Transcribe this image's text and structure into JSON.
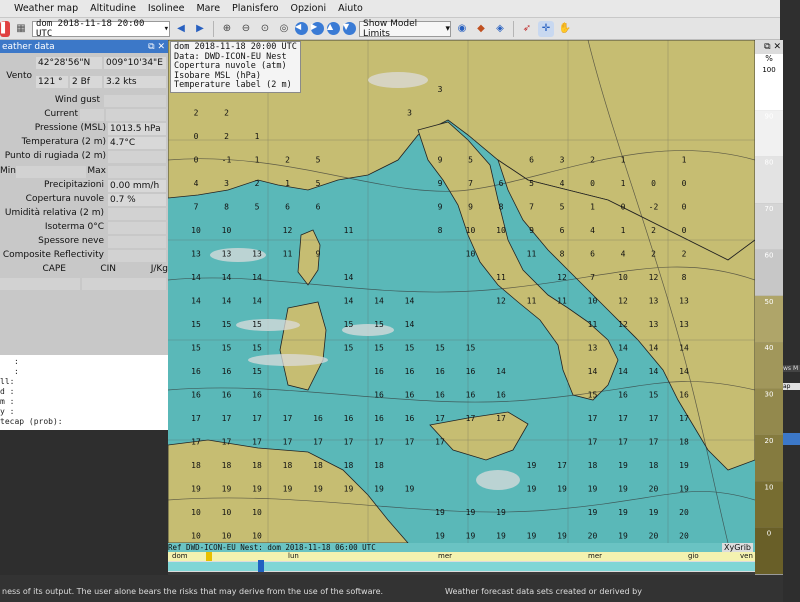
{
  "menu": [
    "Weather map",
    "Altitudine",
    "Isolinee",
    "Mare",
    "Planisfero",
    "Opzioni",
    "Aiuto"
  ],
  "toolbar": {
    "date_value": "dom 2018-11-18 20:00 UTC",
    "model_limits_label": "Show Model Limits"
  },
  "panel": {
    "title": "eather data",
    "lat": "42°28'56\"N",
    "lon": "009°10'34\"E",
    "wind_label": "Vento",
    "wind_dir": "121 °",
    "wind_bf": "2 Bf",
    "wind_kts": "3.2  kts",
    "wind_gust_label": "Wind gust",
    "current_label": "Current",
    "pressure_label": "Pressione (MSL)",
    "pressure_value": "1013.5 hPa",
    "temp_label": "Temperatura (2 m)",
    "temp_value": "4.7°C",
    "dew_label": "Punto di rugiada (2 m)",
    "min_label": "Min",
    "max_label": "Max",
    "precip_label": "Precipitazioni",
    "precip_value": "0.00 mm/h",
    "cloud_label": "Copertura nuvole",
    "cloud_value": "0.7 %",
    "humidity_label": "Umidità relativa (2 m)",
    "iso_label": "Isoterma 0°C",
    "snow_label": "Spessore neve",
    "reflect_label": "Composite Reflectivity",
    "cape_label": "CAPE",
    "cin_label": "CIN",
    "jkg_label": "J/Kg",
    "text_lines": [
      ":",
      ":",
      "ll:",
      "d :",
      "m :",
      "y :",
      "tecap (prob):"
    ],
    "text_prefixes": [
      "",
      "",
      "",
      "",
      "",
      "",
      ""
    ]
  },
  "map": {
    "header_lines": [
      "dom 2018-11-18 20:00 UTC",
      "Data: DWD-ICON-EU Nest",
      "Copertura nuvole (atm)",
      "Isobare MSL (hPa)",
      "Temperature label (2 m)"
    ],
    "footer": "Ref DWD-ICON-EU Nest: dom 2018-11-18 06:00 UTC",
    "brand": "XyGrib",
    "temps": [
      [
        "1",
        "2",
        "2",
        "0",
        "",
        "",
        "3",
        "1",
        "",
        "",
        "",
        "",
        "",
        "",
        "",
        "",
        "",
        ""
      ],
      [
        "2",
        "2",
        "1",
        "",
        "",
        "",
        "3",
        "",
        "",
        "",
        "",
        "",
        "",
        "",
        "",
        "",
        "",
        ""
      ],
      [
        "0",
        "2",
        "1",
        "",
        "",
        "",
        "4",
        "3",
        "",
        "",
        "",
        "",
        "",
        "",
        "",
        "",
        "",
        ""
      ]
    ]
  },
  "timeline": {
    "days": [
      "dom",
      "lun",
      "mer",
      "mer",
      "gio",
      "ven"
    ]
  },
  "legend": {
    "unit": "%",
    "labels": [
      "100",
      "90",
      "80",
      "70",
      "60",
      "50",
      "40",
      "30",
      "20",
      "10",
      "0"
    ]
  },
  "right_edge": [
    "ws M",
    "ap"
  ],
  "bottom": {
    "left_text": "ness of its output. The user alone bears the risks that may derive from the use of the software.",
    "right_text": "Weather forecast data sets created or derived by"
  }
}
